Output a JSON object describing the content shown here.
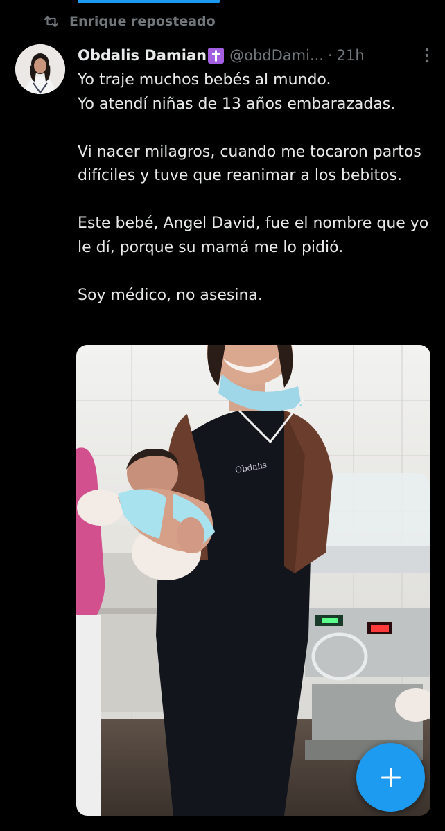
{
  "repost": {
    "text": "Enrique reposteado",
    "icon": "retweet-icon"
  },
  "author": {
    "name": "Obdalis Damian",
    "badge": "latin-cross-icon",
    "handle": "@obdDami...",
    "separator": "·",
    "time": "21h"
  },
  "tweet": {
    "lines": [
      "Yo traje muchos bebés al mundo.",
      "Yo atendí niñas de 13 años embarazadas.",
      "Vi nacer milagros, cuando me tocaron partos difíciles y tuve que reanimar a los bebitos.",
      "Este bebé, Angel David, fue el nombre que yo le dí, porque su mamá me lo pidió.",
      "Soy médico, no asesina."
    ]
  },
  "fab": {
    "icon": "plus-icon"
  },
  "colors": {
    "background": "#000000",
    "text": "#e7e9ea",
    "muted": "#71767b",
    "accent": "#1d9bf0",
    "badge": "#a35fe0"
  }
}
